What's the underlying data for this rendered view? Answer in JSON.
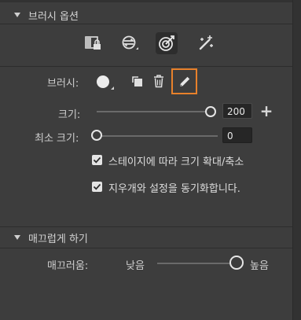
{
  "brush_options": {
    "section_title": "브러시 옵션",
    "modes": [
      {
        "icon": "mask-lock-icon"
      },
      {
        "icon": "exchange-circle-icon"
      },
      {
        "icon": "target-brush-icon",
        "active": true
      },
      {
        "icon": "sparkle-brush-icon"
      }
    ],
    "brush_label": "브러시:",
    "size_label": "크기:",
    "size_value": "200",
    "size_slider_level": 1.0,
    "min_size_label": "최소 크기:",
    "min_size_value": "0",
    "min_size_slider_level": 0.0,
    "checkbox_scale_label": "스테이지에 따라 크기 확대/축소",
    "checkbox_scale_checked": true,
    "checkbox_sync_label": "지우개와 설정을 동기화합니다.",
    "checkbox_sync_checked": true,
    "plus_label": "+"
  },
  "smoothing": {
    "section_title": "매끄럽게 하기",
    "label": "매끄러움:",
    "low_label": "낮음",
    "high_label": "높음",
    "slider_level": 1.0
  },
  "colors": {
    "active_outline": "#e8812b",
    "panel_bg": "#3d3d3d"
  }
}
